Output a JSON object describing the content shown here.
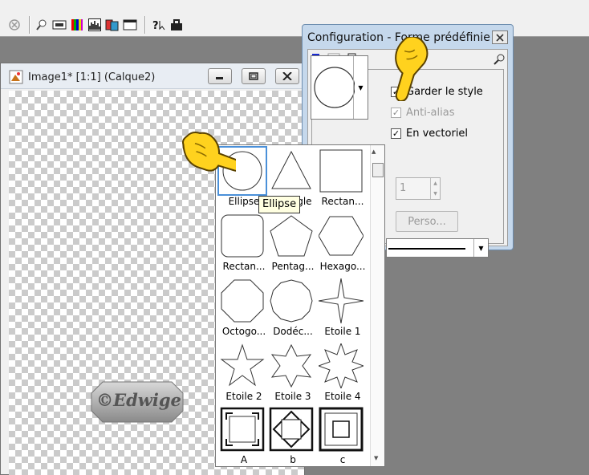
{
  "toolbar": {
    "buttons": [
      {
        "name": "stop-icon"
      },
      {
        "name": "zoom-icon"
      },
      {
        "name": "preview-icon"
      },
      {
        "name": "color-palette-icon"
      },
      {
        "name": "histogram-icon"
      },
      {
        "name": "layers-icon"
      },
      {
        "name": "window-icon"
      },
      {
        "name": "help-icon"
      },
      {
        "name": "tool-options-icon"
      }
    ]
  },
  "image_window": {
    "title": "Image1* [1:1] (Calque2)",
    "buttons": [
      "minimize",
      "restore",
      "close"
    ]
  },
  "watermark": {
    "text": "©Edwige"
  },
  "config_dialog": {
    "title": "Configuration - Forme prédéfinie",
    "tabs": [
      "shape-tab-icon",
      "line-tab-icon",
      "options-tab-icon"
    ],
    "options": [
      {
        "label": "Garder le style",
        "checked": true,
        "enabled": true
      },
      {
        "label": "Anti-alias",
        "checked": true,
        "enabled": false
      },
      {
        "label": "En vectoriel",
        "checked": true,
        "enabled": true
      }
    ],
    "spin_value": "1",
    "perso_label": "Perso..."
  },
  "shape_picker": {
    "items": [
      {
        "label": "Ellipse",
        "shape": "ellipse",
        "selected": true
      },
      {
        "label": "Triangle",
        "shape": "triangle"
      },
      {
        "label": "Rectan...",
        "shape": "square"
      },
      {
        "label": "Rectan...",
        "shape": "rounded-square"
      },
      {
        "label": "Pentag...",
        "shape": "pentagon"
      },
      {
        "label": "Hexago...",
        "shape": "hexagon"
      },
      {
        "label": "Octogo...",
        "shape": "octagon"
      },
      {
        "label": "Dodéc...",
        "shape": "dodecagon"
      },
      {
        "label": "Etoile 1",
        "shape": "star4"
      },
      {
        "label": "Etoile 2",
        "shape": "star5"
      },
      {
        "label": "Etoile 3",
        "shape": "star6"
      },
      {
        "label": "Etoile 4",
        "shape": "star8"
      },
      {
        "label": "A",
        "shape": "frame-a"
      },
      {
        "label": "b",
        "shape": "frame-b"
      },
      {
        "label": "c",
        "shape": "frame-c"
      }
    ]
  },
  "tooltip": {
    "text": "Ellipse"
  },
  "colors": {
    "hand_yellow": "#ffd21e",
    "selection_blue": "#4a90d9",
    "dialog_title_bg": "#c5d8ec"
  }
}
